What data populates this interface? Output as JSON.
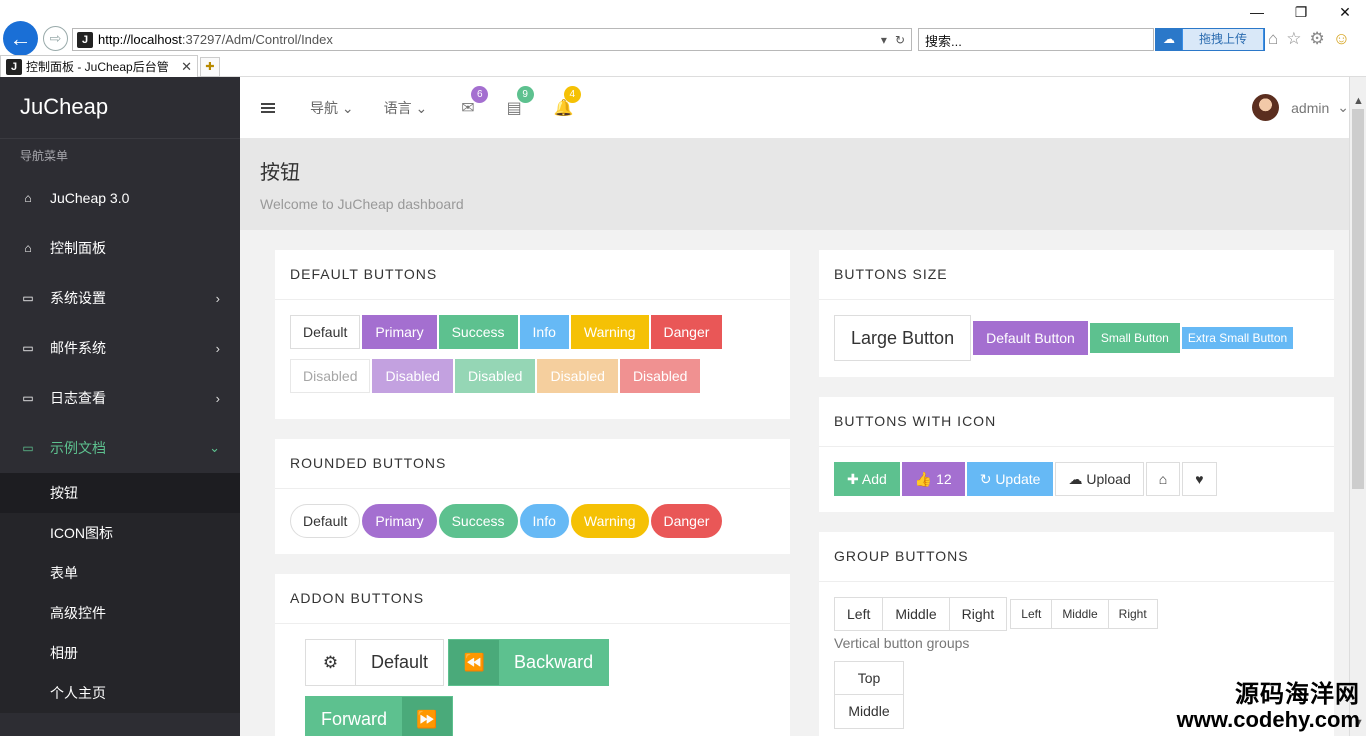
{
  "browser": {
    "url_host": "http://localhost",
    "url_path": ":37297/Adm/Control/Index",
    "search_placeholder": "搜索...",
    "upload_label": "拖拽上传",
    "tab_title": "控制面板 - JuCheap后台管",
    "favicon_letter": "J"
  },
  "sidebar": {
    "brand": "JuCheap",
    "header": "导航菜单",
    "items": [
      {
        "label": "JuCheap 3.0",
        "icon": "home-icon"
      },
      {
        "label": "控制面板",
        "icon": "home-icon"
      },
      {
        "label": "系统设置",
        "icon": "laptop-icon"
      },
      {
        "label": "邮件系统",
        "icon": "laptop-icon"
      },
      {
        "label": "日志查看",
        "icon": "laptop-icon"
      },
      {
        "label": "示例文档",
        "icon": "laptop-icon"
      }
    ],
    "sub_items": [
      "按钮",
      "ICON图标",
      "表单",
      "高级控件",
      "相册",
      "个人主页"
    ]
  },
  "topbar": {
    "nav_label": "导航",
    "lang_label": "语言",
    "mail_count": "6",
    "task_count": "9",
    "notify_count": "4",
    "user_name": "admin"
  },
  "page": {
    "title": "按钮",
    "subtitle": "Welcome to JuCheap dashboard"
  },
  "panels": {
    "default_buttons": {
      "title": "DEFAULT BUTTONS",
      "default": "Default",
      "primary": "Primary",
      "success": "Success",
      "info": "Info",
      "warning": "Warning",
      "danger": "Danger",
      "disabled": "Disabled"
    },
    "rounded_buttons": {
      "title": "ROUNDED BUTTONS",
      "default": "Default",
      "primary": "Primary",
      "success": "Success",
      "info": "Info",
      "warning": "Warning",
      "danger": "Danger"
    },
    "addon_buttons": {
      "title": "ADDON BUTTONS",
      "default": "Default",
      "backward": "Backward",
      "forward": "Forward"
    },
    "buttons_size": {
      "title": "BUTTONS SIZE",
      "large": "Large Button",
      "default": "Default Button",
      "small": "Small Button",
      "extra_small": "Extra Small Button"
    },
    "buttons_with_icon": {
      "title": "BUTTONS WITH ICON",
      "add": "Add",
      "like_count": "12",
      "update": "Update",
      "upload": "Upload"
    },
    "group_buttons": {
      "title": "GROUP BUTTONS",
      "left": "Left",
      "middle": "Middle",
      "right": "Right",
      "vertical_label": "Vertical button groups",
      "top": "Top"
    }
  },
  "watermark": {
    "cn": "源码海洋网",
    "url": "www.codehy.com"
  },
  "colors": {
    "primary": "#a46fd0",
    "success": "#5dc18f",
    "info": "#66b9f5",
    "warning": "#f5c105",
    "danger": "#e95757",
    "sidebar": "#2d2d33"
  }
}
